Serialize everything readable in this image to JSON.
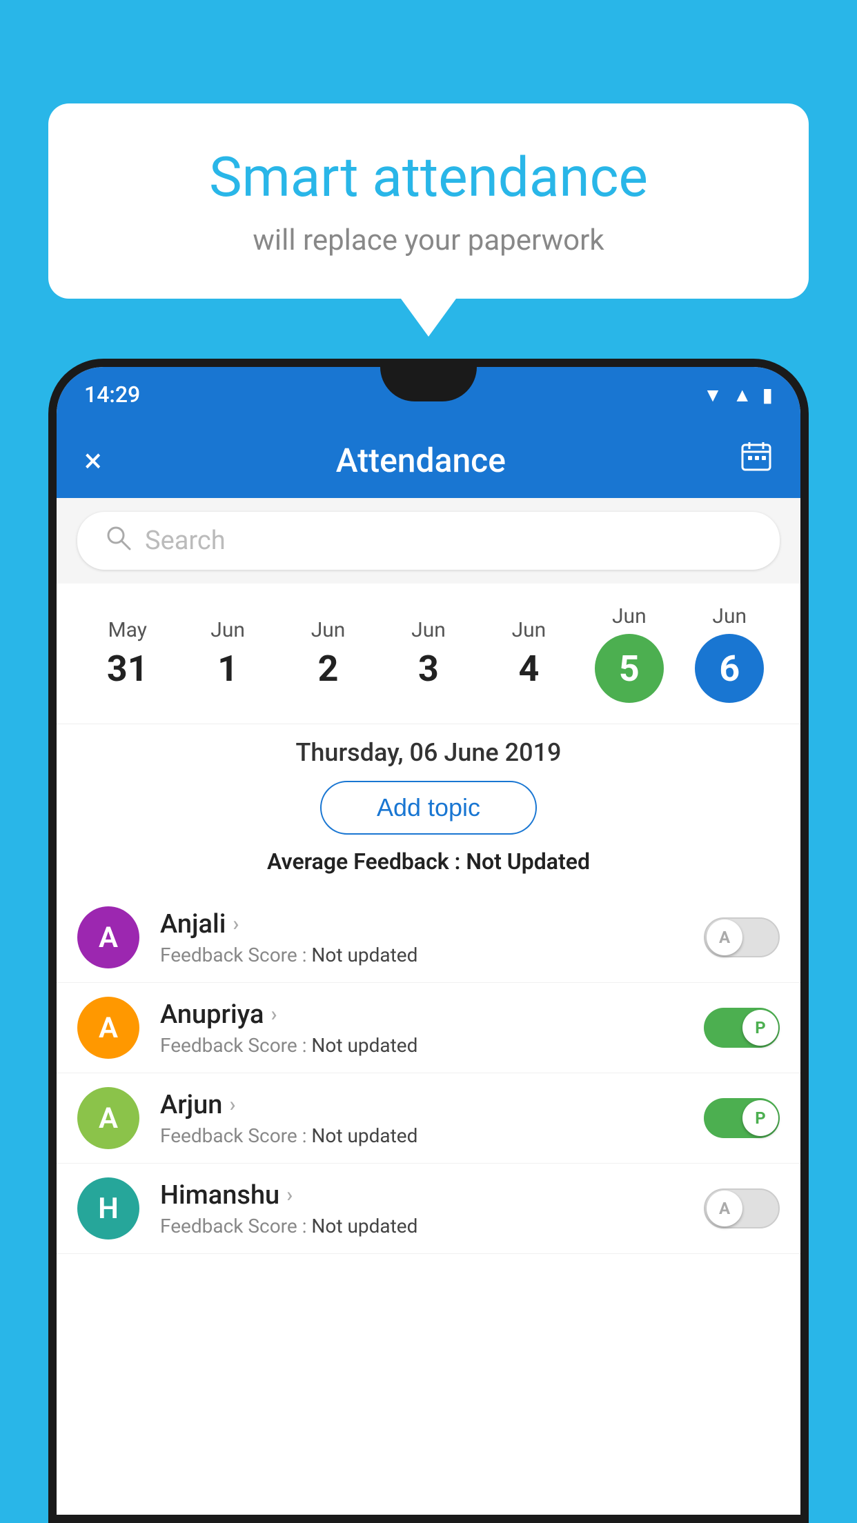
{
  "background_color": "#29b6e8",
  "speech_bubble": {
    "title": "Smart attendance",
    "subtitle": "will replace your paperwork"
  },
  "status_bar": {
    "time": "14:29",
    "icons": [
      "wifi",
      "signal",
      "battery"
    ]
  },
  "app_bar": {
    "title": "Attendance",
    "close_label": "×",
    "calendar_label": "📅"
  },
  "search": {
    "placeholder": "Search"
  },
  "dates": [
    {
      "month": "May",
      "day": "31",
      "type": "normal"
    },
    {
      "month": "Jun",
      "day": "1",
      "type": "normal"
    },
    {
      "month": "Jun",
      "day": "2",
      "type": "normal"
    },
    {
      "month": "Jun",
      "day": "3",
      "type": "normal"
    },
    {
      "month": "Jun",
      "day": "4",
      "type": "normal"
    },
    {
      "month": "Jun",
      "day": "5",
      "type": "green"
    },
    {
      "month": "Jun",
      "day": "6",
      "type": "blue"
    }
  ],
  "selected_date": "Thursday, 06 June 2019",
  "add_topic_label": "Add topic",
  "average_feedback": {
    "label": "Average Feedback : ",
    "value": "Not Updated"
  },
  "students": [
    {
      "name": "Anjali",
      "avatar_letter": "A",
      "avatar_color": "purple",
      "feedback_label": "Feedback Score : ",
      "feedback_value": "Not updated",
      "toggle_state": "off",
      "toggle_letter": "A"
    },
    {
      "name": "Anupriya",
      "avatar_letter": "A",
      "avatar_color": "orange",
      "feedback_label": "Feedback Score : ",
      "feedback_value": "Not updated",
      "toggle_state": "on",
      "toggle_letter": "P"
    },
    {
      "name": "Arjun",
      "avatar_letter": "A",
      "avatar_color": "green",
      "feedback_label": "Feedback Score : ",
      "feedback_value": "Not updated",
      "toggle_state": "on",
      "toggle_letter": "P"
    },
    {
      "name": "Himanshu",
      "avatar_letter": "H",
      "avatar_color": "teal",
      "feedback_label": "Feedback Score : ",
      "feedback_value": "Not updated",
      "toggle_state": "off",
      "toggle_letter": "A"
    }
  ]
}
